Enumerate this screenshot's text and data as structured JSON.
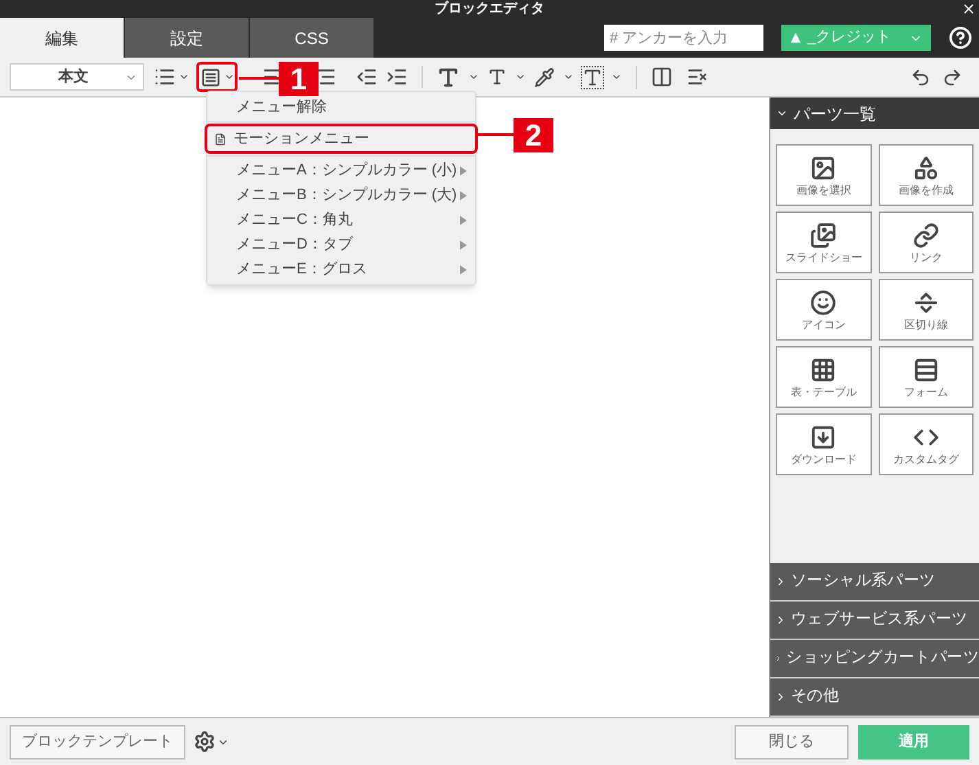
{
  "window": {
    "title": "ブロックエディタ"
  },
  "tabs": [
    {
      "label": "編集",
      "selected": true
    },
    {
      "label": "設定",
      "selected": false
    },
    {
      "label": "CSS",
      "selected": false
    }
  ],
  "anchor_field": {
    "placeholder": "# アンカーを入力"
  },
  "credit_select": {
    "value": "_クレジット"
  },
  "toolbar": {
    "style_select": "本文",
    "menu_button_annotation": "1"
  },
  "dropdown_menu": {
    "items": [
      {
        "label": "メニュー解除",
        "kind": "plain"
      },
      {
        "label": "モーションメニュー",
        "kind": "icon",
        "annotation": "2"
      },
      {
        "label": "メニューA：シンプルカラー (小)",
        "kind": "submenu"
      },
      {
        "label": "メニューB：シンプルカラー (大)",
        "kind": "submenu"
      },
      {
        "label": "メニューC：角丸",
        "kind": "submenu"
      },
      {
        "label": "メニューD：タブ",
        "kind": "submenu"
      },
      {
        "label": "メニューE：グロス",
        "kind": "submenu"
      }
    ]
  },
  "sidebar": {
    "title": "パーツ一覧",
    "expanded": true,
    "parts": [
      {
        "label": "画像を選択"
      },
      {
        "label": "画像を作成"
      },
      {
        "label": "スライドショー"
      },
      {
        "label": "リンク"
      },
      {
        "label": "アイコン"
      },
      {
        "label": "区切り線"
      },
      {
        "label": "表・テーブル"
      },
      {
        "label": "フォーム"
      },
      {
        "label": "ダウンロード"
      },
      {
        "label": "カスタムタグ"
      }
    ],
    "sections": [
      {
        "label": "ソーシャル系パーツ",
        "expanded": false
      },
      {
        "label": "ウェブサービス系パーツ",
        "expanded": false
      },
      {
        "label": "ショッピングカートパーツ",
        "expanded": false
      },
      {
        "label": "その他",
        "expanded": false
      }
    ]
  },
  "footer": {
    "template_button": "ブロックテンプレート",
    "close_button": "閉じる",
    "apply_button": "適用"
  }
}
